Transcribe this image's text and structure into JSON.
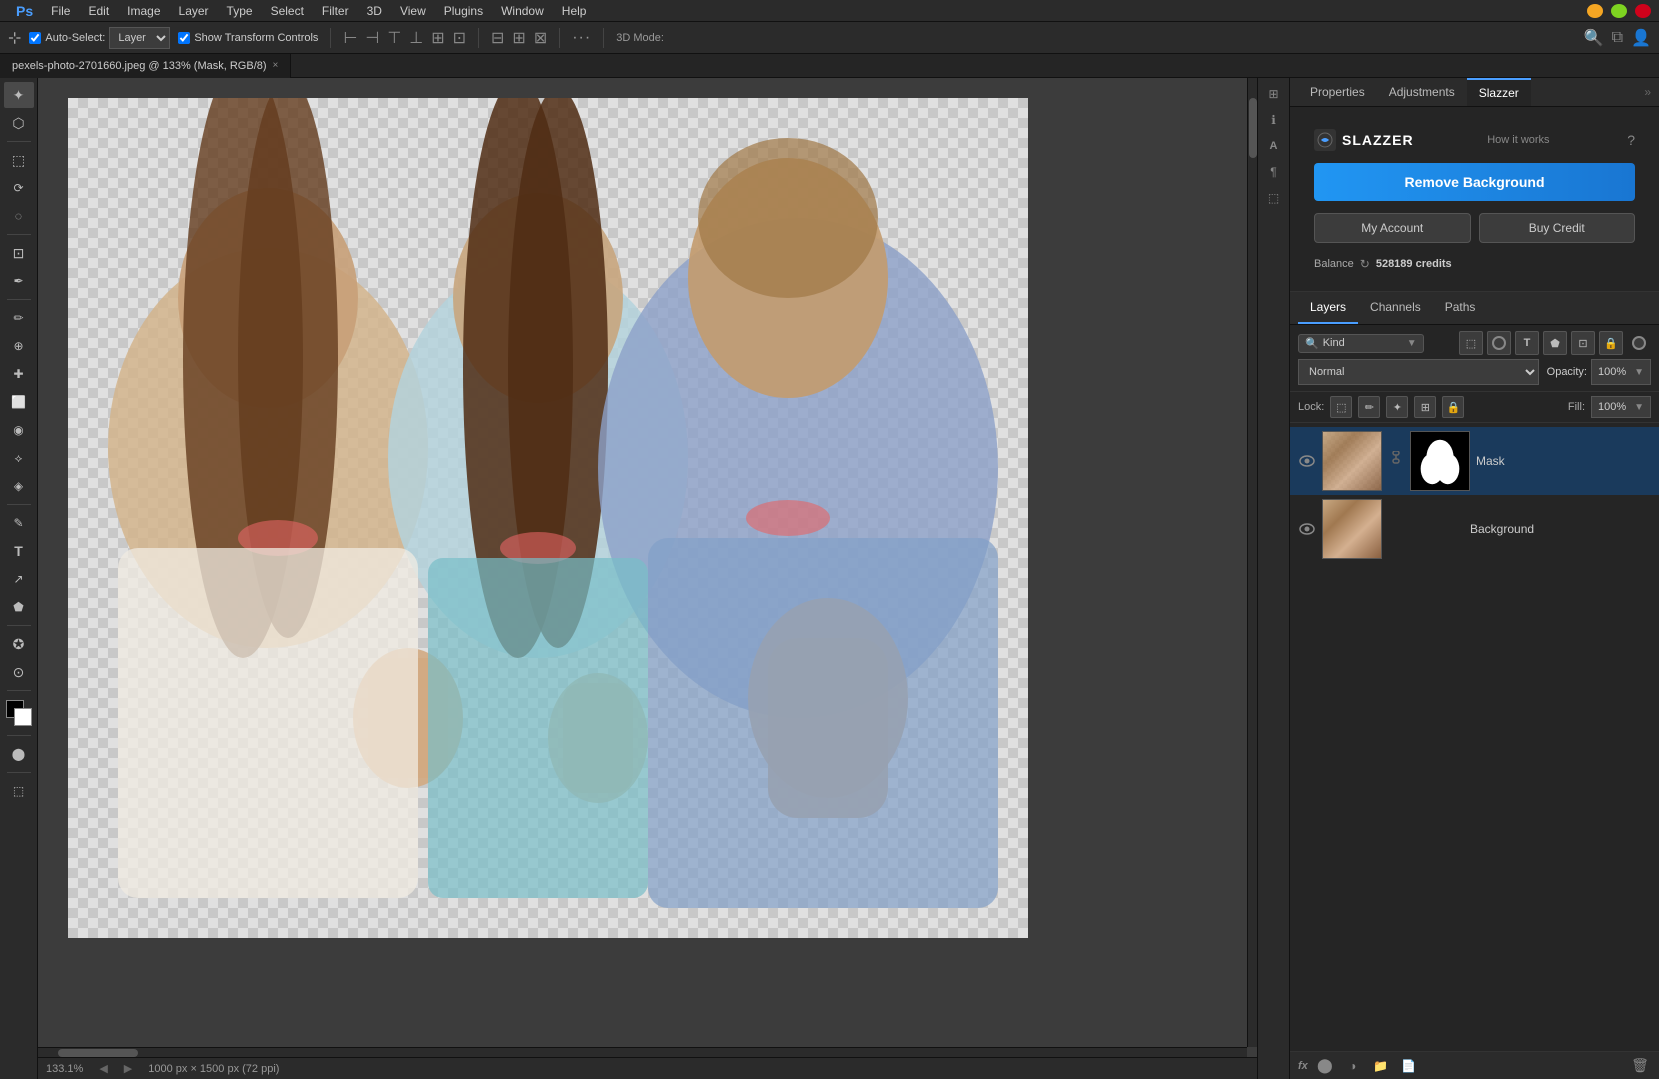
{
  "menubar": {
    "ps_icon": "Ps",
    "items": [
      "File",
      "Edit",
      "Image",
      "Layer",
      "Type",
      "Select",
      "Filter",
      "3D",
      "View",
      "Plugins",
      "Window",
      "Help"
    ]
  },
  "window_controls": {
    "minimize": "−",
    "maximize": "□",
    "close": "×"
  },
  "options_bar": {
    "auto_select_label": "Auto-Select:",
    "auto_select_value": "Layer",
    "show_transform": "Show Transform Controls",
    "mode_label": "3D Mode:",
    "dots": "···"
  },
  "tab": {
    "filename": "pexels-photo-2701660.jpeg @ 133% (Mask, RGB/8)",
    "close": "×"
  },
  "panel_tabs": {
    "properties": "Properties",
    "adjustments": "Adjustments",
    "slazzer": "Slazzer"
  },
  "slazzer": {
    "logo": "SLAZZER",
    "how_it_works": "How it works",
    "remove_bg_btn": "Remove Background",
    "my_account_btn": "My Account",
    "buy_credit_btn": "Buy Credit",
    "balance_label": "Balance",
    "credits": "528189 credits"
  },
  "layers_panel": {
    "tabs": [
      "Layers",
      "Channels",
      "Paths"
    ],
    "kind_label": "Kind",
    "blend_mode": "Normal",
    "opacity_label": "Opacity:",
    "opacity_value": "100%",
    "fill_label": "Fill:",
    "fill_value": "100%",
    "lock_label": "Lock:"
  },
  "layers": [
    {
      "name": "Mask",
      "visible": true,
      "has_mask": true,
      "active": true
    },
    {
      "name": "Background",
      "visible": true,
      "has_mask": false,
      "active": false
    }
  ],
  "status_bar": {
    "zoom": "133.1%",
    "dimensions": "1000 px × 1500 px (72 ppi)"
  },
  "toolbar_tools": [
    "✦",
    "↔",
    "⬡",
    "⬚",
    "✂",
    "✒",
    "⌖",
    "✏",
    "◈",
    "⬤",
    "⟡",
    "✎",
    "⊕",
    "✚",
    "⬜",
    "◉",
    "⟟",
    "T",
    "↗",
    "✪",
    "⊙",
    "⋮⋮⋮"
  ],
  "icons": {
    "eye": "👁",
    "chain": "⛓",
    "refresh": "↻",
    "expand": "»",
    "search": "🔍"
  }
}
